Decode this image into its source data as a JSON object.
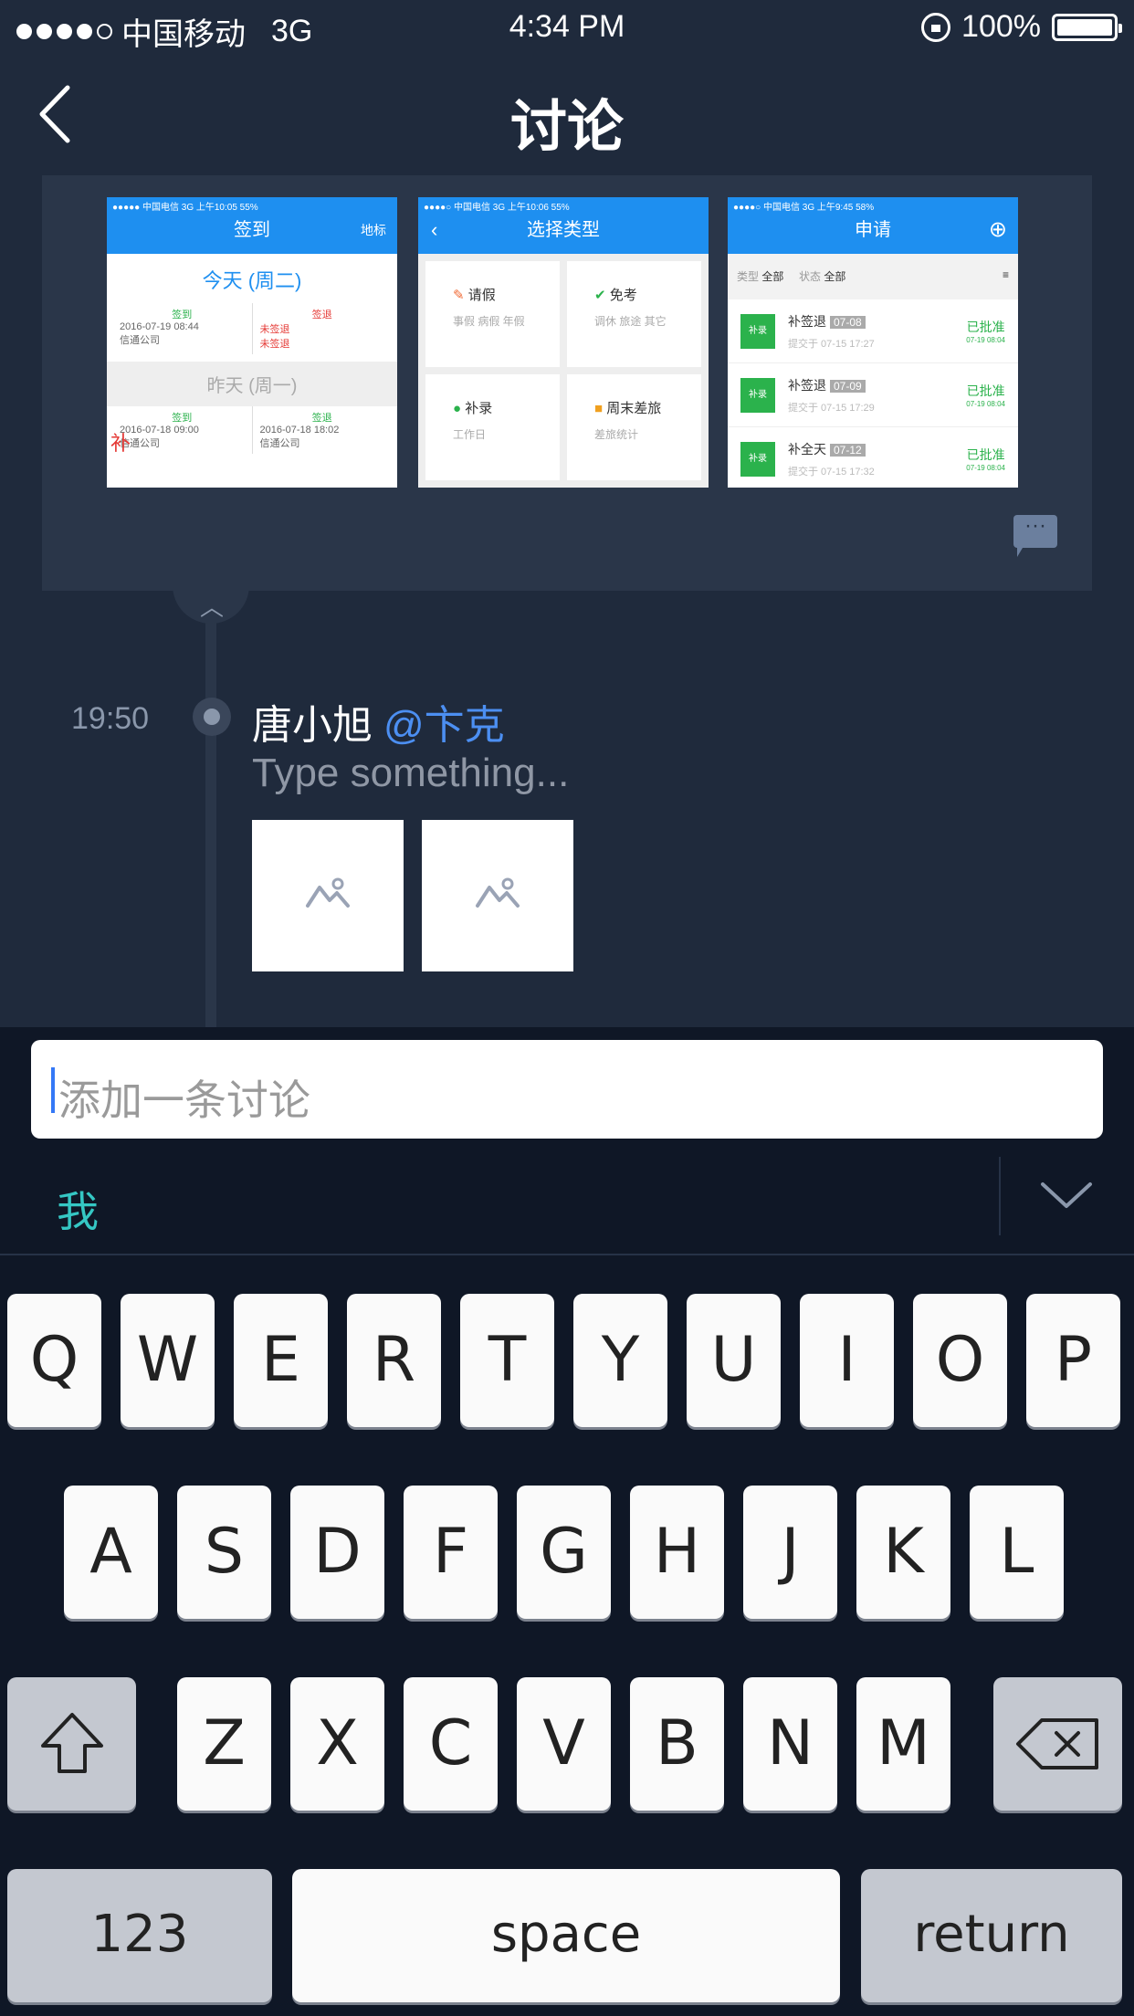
{
  "status_bar": {
    "carrier": "中国移动",
    "network": "3G",
    "time": "4:34 PM",
    "battery": "100%"
  },
  "nav": {
    "title": "讨论",
    "back_icon": "chevron-left-icon"
  },
  "attachment_card": {
    "thumb1": {
      "status": "●●●●● 中国电信 3G 上午10:05 55%",
      "title": "签到",
      "right": "地标",
      "today": "今天 (周二)",
      "checkin_label": "签到",
      "checkout_label": "签退",
      "checkin_time": "2016-07-19 08:44",
      "checkout_status": "未签退",
      "location": "信通公司",
      "yesterday": "昨天 (周一)",
      "badge": "补",
      "y_checkin_time": "2016-07-18 09:00",
      "y_checkout_time": "2016-07-18 18:02"
    },
    "thumb2": {
      "status": "●●●●○ 中国电信 3G 上午10:06 55%",
      "title": "选择类型",
      "cells": [
        {
          "label": "请假",
          "sub": "事假 病假 年假"
        },
        {
          "label": "免考",
          "sub": "调休 旅途 其它"
        },
        {
          "label": "补录",
          "sub": "工作日"
        },
        {
          "label": "周末差旅",
          "sub": "差旅统计"
        }
      ]
    },
    "thumb3": {
      "status": "●●●●○ 中国电信 3G 上午9:45 58%",
      "title": "申请",
      "filter_type_label": "类型",
      "filter_type": "全部",
      "filter_state_label": "状态",
      "filter_state": "全部",
      "items": [
        {
          "tag": "补录",
          "title": "补签退",
          "date": "07-08",
          "sub": "提交于 07-15 17:27",
          "status": "已批准",
          "status_date": "07-19 08:04"
        },
        {
          "tag": "补录",
          "title": "补签退",
          "date": "07-09",
          "sub": "提交于 07-15 17:29",
          "status": "已批准",
          "status_date": "07-19 08:04"
        },
        {
          "tag": "补录",
          "title": "补全天",
          "date": "07-12",
          "sub": "提交于 07-15 17:32",
          "status": "已批准",
          "status_date": "07-19 08:04"
        }
      ]
    },
    "comment_icon": "chat-bubble-icon"
  },
  "entry": {
    "time": "19:50",
    "author": "唐小旭",
    "mention": "@卞克",
    "text": "Type something..."
  },
  "composer": {
    "placeholder": "添加一条讨论",
    "me_label": "我"
  },
  "keyboard": {
    "row1": [
      "Q",
      "W",
      "E",
      "R",
      "T",
      "Y",
      "U",
      "I",
      "O",
      "P"
    ],
    "row2": [
      "A",
      "S",
      "D",
      "F",
      "G",
      "H",
      "J",
      "K",
      "L"
    ],
    "row3": [
      "Z",
      "X",
      "C",
      "V",
      "B",
      "N",
      "M"
    ],
    "numbers": "123",
    "space": "space",
    "return": "return"
  }
}
